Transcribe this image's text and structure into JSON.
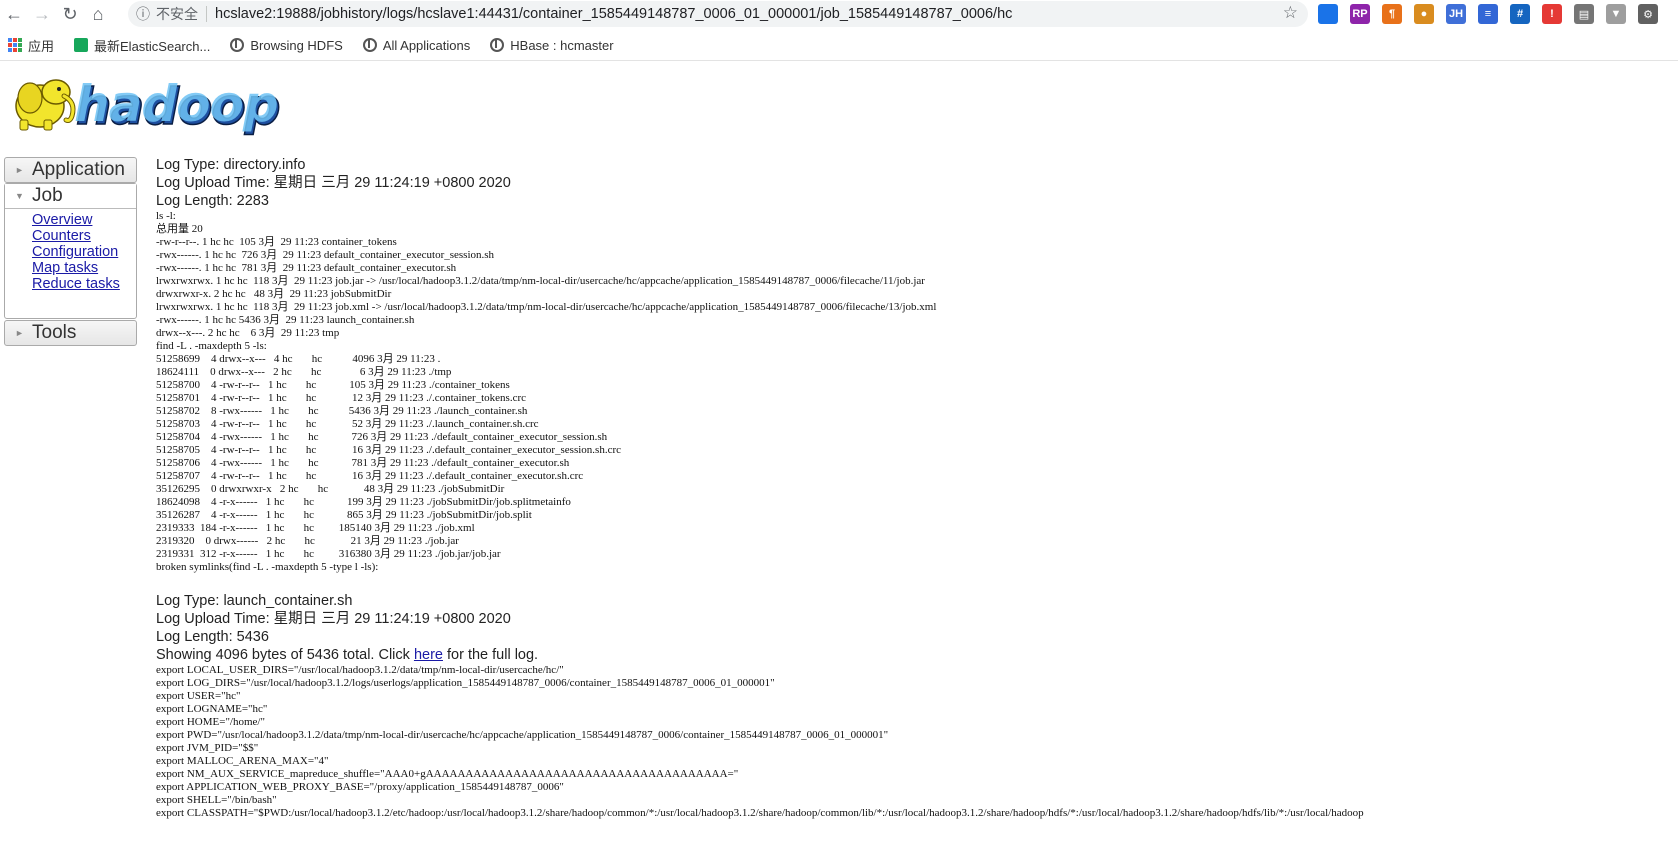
{
  "browser": {
    "security_label": "不安全",
    "url": "hcslave2:19888/jobhistory/logs/hcslave1:44431/container_1585449148787_0006_01_000001/job_1585449148787_0006/hc",
    "bookmarks": [
      "应用",
      "最新ElasticSearch...",
      "Browsing HDFS",
      "All Applications",
      "HBase : hcmaster"
    ],
    "extensions": [
      {
        "name": "ext-1",
        "label": "",
        "color": "#1a73e8"
      },
      {
        "name": "ext-2",
        "label": "RP",
        "color": "#8e24aa"
      },
      {
        "name": "ext-3",
        "label": "¶",
        "color": "#e8711a"
      },
      {
        "name": "ext-4",
        "label": "●",
        "color": "#d98c1f"
      },
      {
        "name": "ext-5",
        "label": "JH",
        "color": "#3f6fd8"
      },
      {
        "name": "ext-6",
        "label": "≡",
        "color": "#3367d6"
      },
      {
        "name": "ext-7",
        "label": "#",
        "color": "#1565c0"
      },
      {
        "name": "ext-8",
        "label": "!",
        "color": "#e53935"
      },
      {
        "name": "ext-9",
        "label": "▤",
        "color": "#757575"
      },
      {
        "name": "ext-10",
        "label": "▼",
        "color": "#9e9e9e"
      },
      {
        "name": "ext-11",
        "label": "⚙",
        "color": "#616161"
      }
    ]
  },
  "logo": {
    "text": "hadoop"
  },
  "sidebar": {
    "application": "Application",
    "job": "Job",
    "job_links": [
      "Overview",
      "Counters",
      "Configuration",
      "Map tasks",
      "Reduce tasks"
    ],
    "tools": "Tools"
  },
  "logs": [
    {
      "type": "Log Type: directory.info",
      "upload": "Log Upload Time: 星期日 三月 29 11:24:19 +0800 2020",
      "length": "Log Length: 2283",
      "showing": "",
      "content": "ls -l:\n总用量 20\n-rw-r--r--. 1 hc hc  105 3月  29 11:23 container_tokens\n-rwx------. 1 hc hc  726 3月  29 11:23 default_container_executor_session.sh\n-rwx------. 1 hc hc  781 3月  29 11:23 default_container_executor.sh\nlrwxrwxrwx. 1 hc hc  118 3月  29 11:23 job.jar -> /usr/local/hadoop3.1.2/data/tmp/nm-local-dir/usercache/hc/appcache/application_1585449148787_0006/filecache/11/job.jar\ndrwxrwxr-x. 2 hc hc   48 3月  29 11:23 jobSubmitDir\nlrwxrwxrwx. 1 hc hc  118 3月  29 11:23 job.xml -> /usr/local/hadoop3.1.2/data/tmp/nm-local-dir/usercache/hc/appcache/application_1585449148787_0006/filecache/13/job.xml\n-rwx------. 1 hc hc 5436 3月  29 11:23 launch_container.sh\ndrwx--x---. 2 hc hc    6 3月  29 11:23 tmp\nfind -L . -maxdepth 5 -ls:\n51258699    4 drwx--x---   4 hc       hc           4096 3月 29 11:23 .\n18624111    0 drwx--x---   2 hc       hc              6 3月 29 11:23 ./tmp\n51258700    4 -rw-r--r--   1 hc       hc            105 3月 29 11:23 ./container_tokens\n51258701    4 -rw-r--r--   1 hc       hc             12 3月 29 11:23 ./.container_tokens.crc\n51258702    8 -rwx------   1 hc       hc           5436 3月 29 11:23 ./launch_container.sh\n51258703    4 -rw-r--r--   1 hc       hc             52 3月 29 11:23 ./.launch_container.sh.crc\n51258704    4 -rwx------   1 hc       hc            726 3月 29 11:23 ./default_container_executor_session.sh\n51258705    4 -rw-r--r--   1 hc       hc             16 3月 29 11:23 ./.default_container_executor_session.sh.crc\n51258706    4 -rwx------   1 hc       hc            781 3月 29 11:23 ./default_container_executor.sh\n51258707    4 -rw-r--r--   1 hc       hc             16 3月 29 11:23 ./.default_container_executor.sh.crc\n35126295    0 drwxrwxr-x   2 hc       hc             48 3月 29 11:23 ./jobSubmitDir\n18624098    4 -r-x------   1 hc       hc            199 3月 29 11:23 ./jobSubmitDir/job.splitmetainfo\n35126287    4 -r-x------   1 hc       hc            865 3月 29 11:23 ./jobSubmitDir/job.split\n2319333  184 -r-x------   1 hc       hc         185140 3月 29 11:23 ./job.xml\n2319320    0 drwx------   2 hc       hc             21 3月 29 11:23 ./job.jar\n2319331  312 -r-x------   1 hc       hc         316380 3月 29 11:23 ./job.jar/job.jar\nbroken symlinks(find -L . -maxdepth 5 -type l -ls):"
    },
    {
      "type": "Log Type: launch_container.sh",
      "upload": "Log Upload Time: 星期日 三月 29 11:24:19 +0800 2020",
      "length": "Log Length: 5436",
      "showing_prefix": "Showing 4096 bytes of 5436 total. Click ",
      "showing_link": "here",
      "showing_suffix": " for the full log.",
      "content": "export LOCAL_USER_DIRS=\"/usr/local/hadoop3.1.2/data/tmp/nm-local-dir/usercache/hc/\"\nexport LOG_DIRS=\"/usr/local/hadoop3.1.2/logs/userlogs/application_1585449148787_0006/container_1585449148787_0006_01_000001\"\nexport USER=\"hc\"\nexport LOGNAME=\"hc\"\nexport HOME=\"/home/\"\nexport PWD=\"/usr/local/hadoop3.1.2/data/tmp/nm-local-dir/usercache/hc/appcache/application_1585449148787_0006/container_1585449148787_0006_01_000001\"\nexport JVM_PID=\"$$\"\nexport MALLOC_ARENA_MAX=\"4\"\nexport NM_AUX_SERVICE_mapreduce_shuffle=\"AAA0+gAAAAAAAAAAAAAAAAAAAAAAAAAAAAAAAAAAAAAA=\"\nexport APPLICATION_WEB_PROXY_BASE=\"/proxy/application_1585449148787_0006\"\nexport SHELL=\"/bin/bash\"\nexport CLASSPATH=\"$PWD:/usr/local/hadoop3.1.2/etc/hadoop:/usr/local/hadoop3.1.2/share/hadoop/common/*:/usr/local/hadoop3.1.2/share/hadoop/common/lib/*:/usr/local/hadoop3.1.2/share/hadoop/hdfs/*:/usr/local/hadoop3.1.2/share/hadoop/hdfs/lib/*:/usr/local/hadoop"
    }
  ]
}
